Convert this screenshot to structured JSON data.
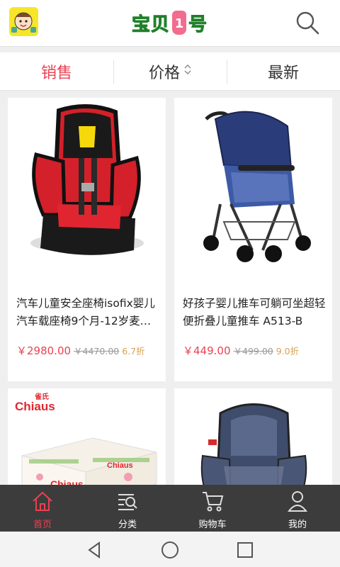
{
  "header": {
    "brand": {
      "left": "宝贝",
      "badge": "1",
      "right": "号"
    },
    "app_icon": "baby-face-icon",
    "search_icon": "search-icon"
  },
  "sort_tabs": [
    {
      "label": "销售",
      "active": true
    },
    {
      "label": "价格",
      "active": false,
      "icon": "sort-updown-icon"
    },
    {
      "label": "最新",
      "active": false
    }
  ],
  "products": [
    {
      "title": "汽车儿童安全座椅isofix婴儿汽车载座椅9个月-12岁麦…",
      "price": "￥2980.00",
      "original_price": "￥4470.00",
      "discount": "6.7折"
    },
    {
      "title": "好孩子婴儿推车可躺可坐超轻便折叠儿童推车 A513-B",
      "price": "￥449.00",
      "original_price": "￥499.00",
      "discount": "9.0折"
    },
    {
      "brand_logo": "Chiaus",
      "brand_logo_cn": "雀氏"
    },
    {}
  ],
  "bottom_nav": [
    {
      "label": "首页",
      "icon": "home-icon",
      "active": true
    },
    {
      "label": "分类",
      "icon": "category-search-icon",
      "active": false
    },
    {
      "label": "购物车",
      "icon": "cart-icon",
      "active": false
    },
    {
      "label": "我的",
      "icon": "user-icon",
      "active": false
    }
  ],
  "colors": {
    "accent": "#e94151",
    "discount": "#d9a24f",
    "nav_bg": "#3c3c3c"
  }
}
